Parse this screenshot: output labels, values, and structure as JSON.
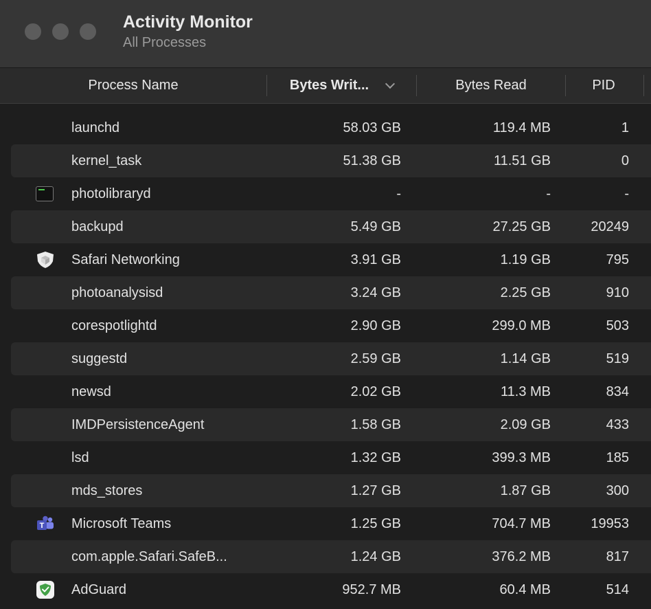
{
  "window": {
    "title": "Activity Monitor",
    "subtitle": "All Processes"
  },
  "columns": {
    "name": "Process Name",
    "bytes_written": "Bytes Writ...",
    "bytes_read": "Bytes Read",
    "pid": "PID"
  },
  "rows": [
    {
      "name": "launchd",
      "written": "58.03 GB",
      "read": "119.4 MB",
      "pid": "1",
      "icon": "none"
    },
    {
      "name": "kernel_task",
      "written": "51.38 GB",
      "read": "11.51 GB",
      "pid": "0",
      "icon": "none"
    },
    {
      "name": "photolibraryd",
      "written": "-",
      "read": "-",
      "pid": "-",
      "icon": "terminal-icon"
    },
    {
      "name": "backupd",
      "written": "5.49 GB",
      "read": "27.25 GB",
      "pid": "20249",
      "icon": "none"
    },
    {
      "name": "Safari Networking",
      "written": "3.91 GB",
      "read": "1.19 GB",
      "pid": "795",
      "icon": "shield-icon"
    },
    {
      "name": "photoanalysisd",
      "written": "3.24 GB",
      "read": "2.25 GB",
      "pid": "910",
      "icon": "none"
    },
    {
      "name": "corespotlightd",
      "written": "2.90 GB",
      "read": "299.0 MB",
      "pid": "503",
      "icon": "none"
    },
    {
      "name": "suggestd",
      "written": "2.59 GB",
      "read": "1.14 GB",
      "pid": "519",
      "icon": "none"
    },
    {
      "name": "newsd",
      "written": "2.02 GB",
      "read": "11.3 MB",
      "pid": "834",
      "icon": "none"
    },
    {
      "name": "IMDPersistenceAgent",
      "written": "1.58 GB",
      "read": "2.09 GB",
      "pid": "433",
      "icon": "none"
    },
    {
      "name": "lsd",
      "written": "1.32 GB",
      "read": "399.3 MB",
      "pid": "185",
      "icon": "none"
    },
    {
      "name": "mds_stores",
      "written": "1.27 GB",
      "read": "1.87 GB",
      "pid": "300",
      "icon": "none"
    },
    {
      "name": "Microsoft Teams",
      "written": "1.25 GB",
      "read": "704.7 MB",
      "pid": "19953",
      "icon": "teams-icon"
    },
    {
      "name": "com.apple.Safari.SafeB...",
      "written": "1.24 GB",
      "read": "376.2 MB",
      "pid": "817",
      "icon": "none"
    },
    {
      "name": "AdGuard",
      "written": "952.7 MB",
      "read": "60.4 MB",
      "pid": "514",
      "icon": "adguard-icon"
    }
  ],
  "colors": {
    "background": "#1e1e1e",
    "titlebar": "#363636",
    "alt_row": "#2a2a2a",
    "teams_purple": "#5b5fc7",
    "adguard_green": "#43a047"
  }
}
